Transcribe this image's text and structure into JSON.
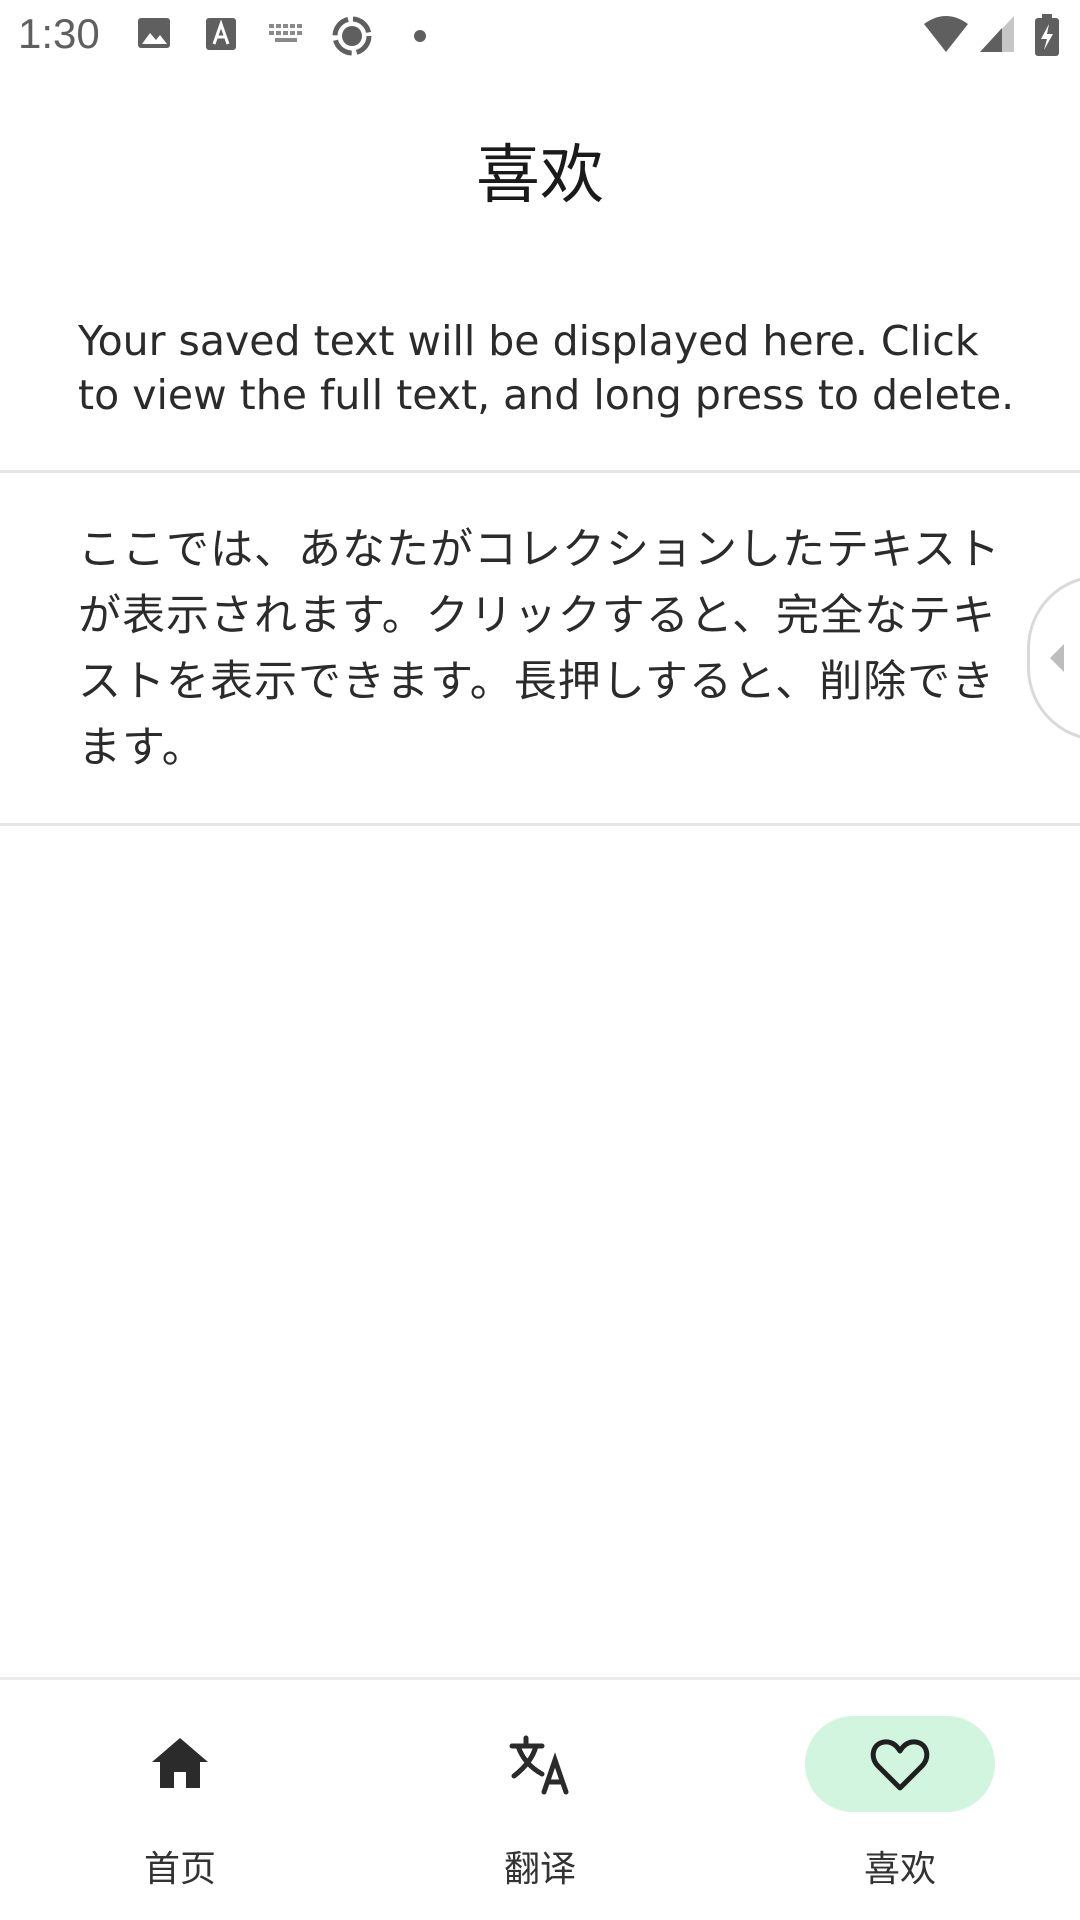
{
  "status_bar": {
    "time": "1:30",
    "icons": [
      "image-icon",
      "text-a-icon",
      "keyboard-icon",
      "record-icon",
      "dot-icon",
      "wifi-icon",
      "signal-icon",
      "battery-charging-icon"
    ]
  },
  "header": {
    "title": "喜欢"
  },
  "saved_items": [
    {
      "text": "Your saved text will be displayed here. Click to view the full text, and long press to delete."
    },
    {
      "text": "ここでは、あなたがコレクションしたテキストが表示されます。クリックすると、完全なテキストを表示できます。長押しすると、削除できます。"
    }
  ],
  "bottom_nav": {
    "items": [
      {
        "label": "首页",
        "icon": "home-icon",
        "active": false
      },
      {
        "label": "翻译",
        "icon": "translate-icon",
        "active": false
      },
      {
        "label": "喜欢",
        "icon": "heart-icon",
        "active": true
      }
    ]
  },
  "colors": {
    "active_pill": "#d2f5e0",
    "divider": "#e6e6e6"
  }
}
